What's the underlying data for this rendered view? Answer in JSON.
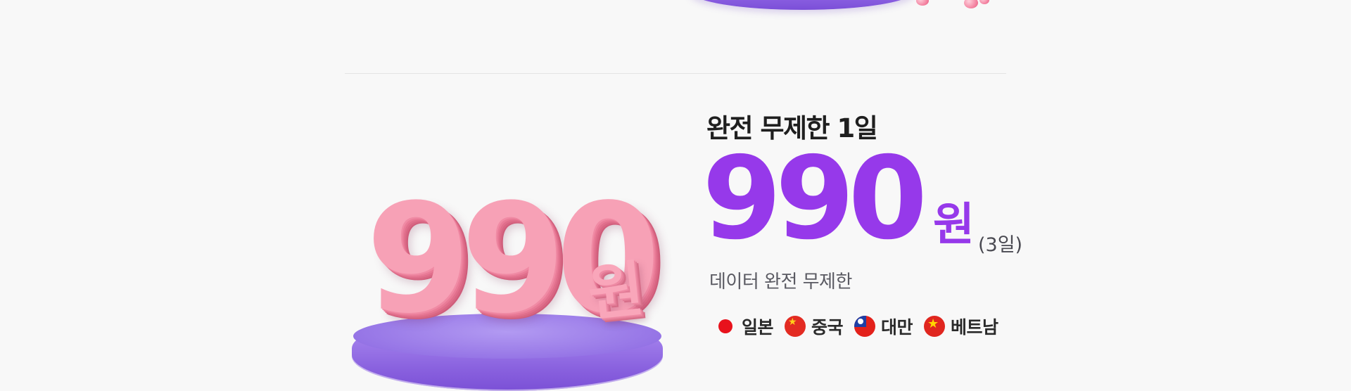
{
  "graphic": {
    "amount": "990",
    "won": "원"
  },
  "plan": {
    "title": "완전 무제한 1일",
    "price_amount": "990",
    "price_currency": "원",
    "price_duration": "(3일)",
    "description": "데이터 완전 무제한"
  },
  "countries": [
    {
      "label": "일본",
      "flag_icon": "japan-flag-icon"
    },
    {
      "label": "중국",
      "flag_icon": "china-flag-icon"
    },
    {
      "label": "대만",
      "flag_icon": "taiwan-flag-icon"
    },
    {
      "label": "베트남",
      "flag_icon": "vietnam-flag-icon"
    }
  ],
  "colors": {
    "price": "#9639ea",
    "title": "#1f1f1f",
    "graphic_pink": "#f7a1b6",
    "podium_purple": "#8e63e3"
  }
}
